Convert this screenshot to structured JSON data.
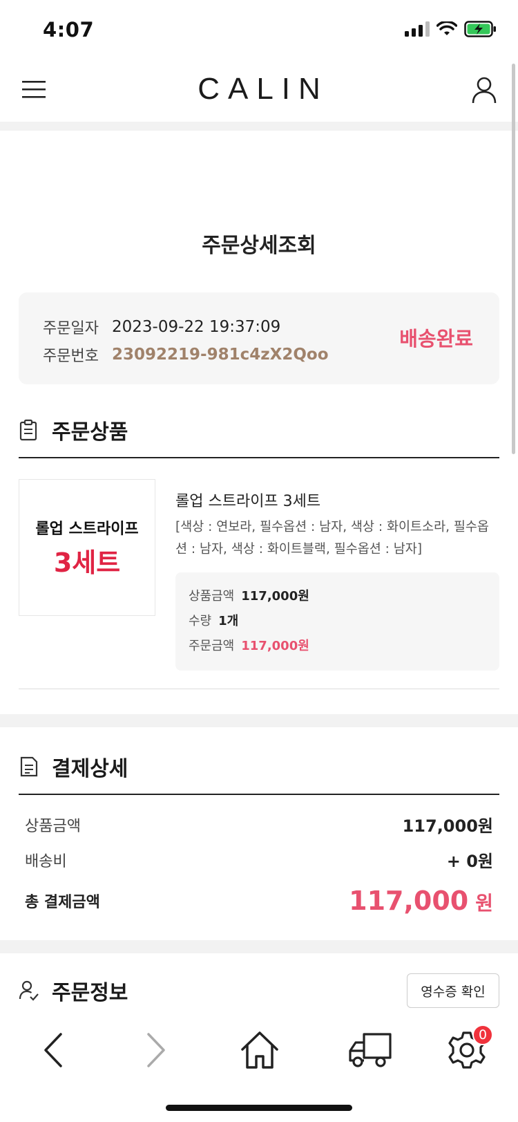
{
  "status_bar": {
    "time": "4:07"
  },
  "header": {
    "brand": "CALIN"
  },
  "page": {
    "title": "주문상세조회"
  },
  "order_summary": {
    "date_label": "주문일자",
    "date_value": "2023-09-22 19:37:09",
    "number_label": "주문번호",
    "number_value": "23092219-981c4zX2Qoo",
    "status": "배송완료"
  },
  "products_section": {
    "title": "주문상품",
    "items": [
      {
        "thumb_line1": "롤업 스트라이프",
        "thumb_line2": "3세트",
        "name": "롤업 스트라이프 3세트",
        "options": "[색상 : 연보라, 필수옵션 : 남자, 색상 : 화이트소라, 필수옵션 : 남자, 색상 : 화이트블랙, 필수옵션 : 남자]",
        "price_label": "상품금액",
        "price_value": "117,000원",
        "qty_label": "수량",
        "qty_value": "1개",
        "order_amount_label": "주문금액",
        "order_amount_value": "117,000원"
      }
    ]
  },
  "payment_section": {
    "title": "결제상세",
    "product_amount_label": "상품금액",
    "product_amount_value": "117,000원",
    "shipping_label": "배송비",
    "shipping_value": "+ 0원",
    "total_label": "총 결제금액",
    "total_value": "117,000",
    "total_unit": "원"
  },
  "order_info_section": {
    "title": "주문정보",
    "receipt_button": "영수증 확인"
  },
  "bottom_nav": {
    "items": [
      {
        "icon": "back-icon"
      },
      {
        "icon": "forward-icon"
      },
      {
        "icon": "home-icon"
      },
      {
        "icon": "delivery-truck-icon"
      },
      {
        "icon": "settings-gear-icon",
        "badge": "0"
      }
    ]
  },
  "colors": {
    "accent_pink": "#e8516f",
    "order_no_brown": "#a0826a",
    "thumb_red": "#e02444"
  }
}
